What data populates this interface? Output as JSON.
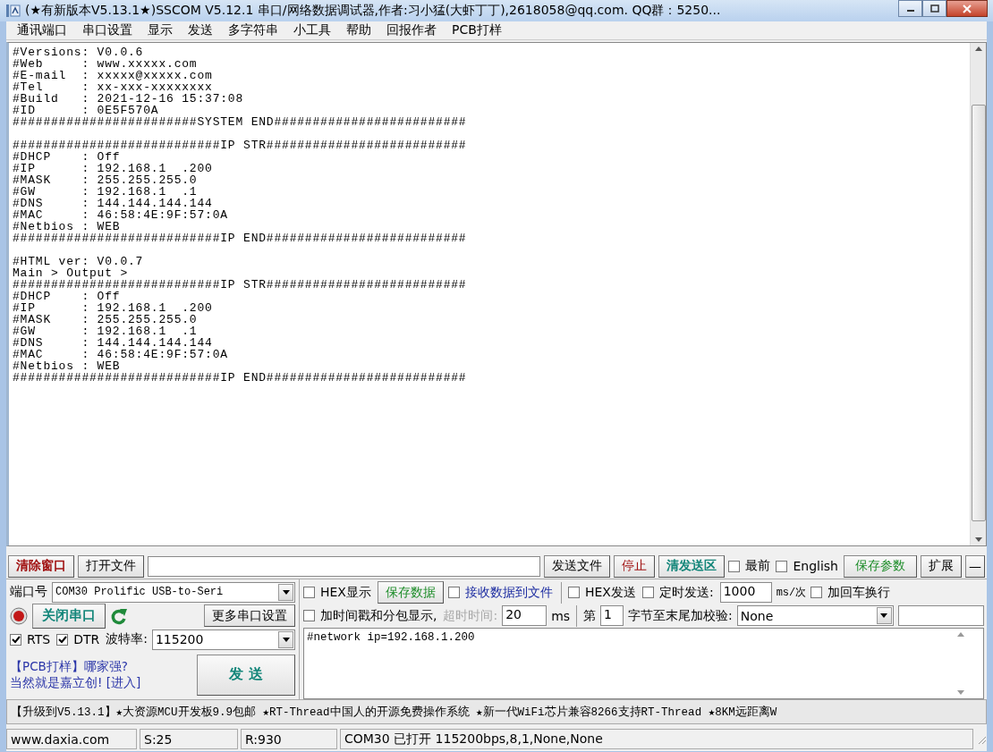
{
  "window": {
    "title": "(★有新版本V5.13.1★)SSCOM V5.12.1 串口/网络数据调试器,作者:习小猛(大虾丁丁),2618058@qq.com. QQ群：5250..."
  },
  "menu": [
    "通讯端口",
    "串口设置",
    "显示",
    "发送",
    "多字符串",
    "小工具",
    "帮助",
    "回报作者",
    "PCB打样"
  ],
  "receive_blocks": [
    [
      "#Versions: V0.0.6",
      "#Web     : www.xxxxx.com",
      "#E-mail  : xxxxx@xxxxx.com",
      "#Tel     : xx-xxx-xxxxxxxx",
      "#Build   : 2021-12-16 15:37:08",
      "#ID      : 0E5F570A",
      "########################SYSTEM END#########################"
    ],
    [
      "###########################IP STR##########################",
      "#DHCP    : Off",
      "#IP      : 192.168.1  .200",
      "#MASK    : 255.255.255.0",
      "#GW      : 192.168.1  .1",
      "#DNS     : 144.144.144.144",
      "#MAC     : 46:58:4E:9F:57:0A",
      "#Netbios : WEB",
      "###########################IP END##########################"
    ],
    [
      "#HTML ver: V0.0.7",
      "Main > Output >",
      "###########################IP STR##########################",
      "#DHCP    : Off",
      "#IP      : 192.168.1  .200",
      "#MASK    : 255.255.255.0",
      "#GW      : 192.168.1  .1",
      "#DNS     : 144.144.144.144",
      "#MAC     : 46:58:4E:9F:57:0A",
      "#Netbios : WEB",
      "###########################IP END##########################"
    ]
  ],
  "toolbar": {
    "clear_button": "清除窗口",
    "open_file_button": "打开文件",
    "send_file_button": "发送文件",
    "stop_button": "停止",
    "clear_send_button": "清发送区",
    "topmost": {
      "label": "最前",
      "checked": false
    },
    "english": {
      "label": "English",
      "checked": false
    },
    "save_params_button": "保存参数",
    "expand_button": "扩展",
    "collapse_button": "—"
  },
  "port": {
    "label": "端口号",
    "value": "COM30 Prolific USB-to-Seri",
    "open": true,
    "close_button": "关闭串口",
    "more_settings_button": "更多串口设置",
    "rts": {
      "label": "RTS",
      "checked": true
    },
    "dtr": {
      "label": "DTR",
      "checked": true
    },
    "baud_label": "波特率:",
    "baud_value": "115200",
    "ad_line_1": "【PCB打样】哪家强?",
    "ad_line_2": "当然就是嘉立创! [进入]",
    "send_button": "发  送"
  },
  "receive_options": {
    "hex_display": {
      "label": "HEX显示",
      "checked": false
    },
    "save_data_button": "保存数据",
    "receive_to_file": {
      "label": "接收数据到文件",
      "checked": false
    },
    "timestamp": {
      "label": "加时间戳和分包显示,",
      "checked": false
    },
    "timeout_label": "超时时间:",
    "timeout_value": "20",
    "timeout_unit": "ms"
  },
  "send_options": {
    "hex_send": {
      "label": "HEX发送",
      "checked": false
    },
    "timed_send": {
      "label": "定时发送:",
      "checked": false
    },
    "interval": "1000",
    "interval_unit": "ms/次",
    "add_newline": {
      "label": "加回车换行",
      "checked": false
    },
    "checksum_prefix": "第",
    "checksum_start": "1",
    "checksum_label": "字节至末尾加校验:",
    "checksum_value": "None"
  },
  "send_text": "#network ip=192.168.1.200",
  "ticker": "【升级到V5.13.1】★大资源MCU开发板9.9包邮 ★RT-Thread中国人的开源免费操作系统 ★新一代WiFi芯片兼容8266支持RT-Thread ★8KM远距离W",
  "status_bar": [
    "www.daxia.com",
    "S:25",
    "R:930",
    "COM30 已打开  115200bps,8,1,None,None"
  ]
}
